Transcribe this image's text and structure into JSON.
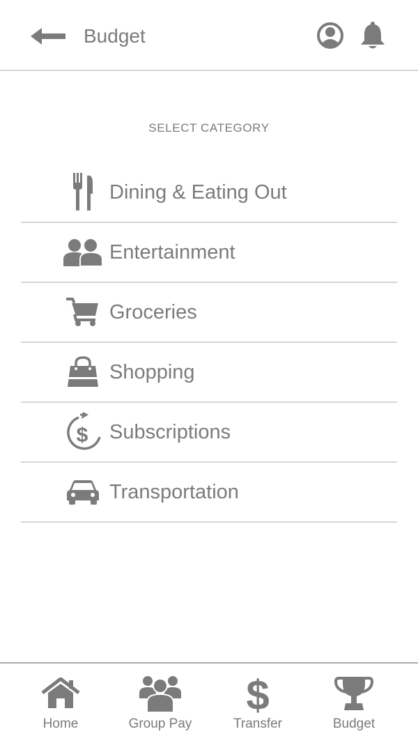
{
  "header": {
    "title": "Budget",
    "back_icon": "arrow-left-icon",
    "profile_icon": "user-circle-icon",
    "notification_icon": "bell-icon"
  },
  "section_title": "SELECT CATEGORY",
  "categories": [
    {
      "label": "Dining & Eating Out",
      "icon": "fork-knife-icon"
    },
    {
      "label": "Entertainment",
      "icon": "people-icon"
    },
    {
      "label": "Groceries",
      "icon": "cart-icon"
    },
    {
      "label": "Shopping",
      "icon": "shopping-bag-icon"
    },
    {
      "label": "Subscriptions",
      "icon": "recurring-dollar-icon"
    },
    {
      "label": "Transportation",
      "icon": "car-icon"
    }
  ],
  "bottom_nav": [
    {
      "label": "Home",
      "icon": "home-icon"
    },
    {
      "label": "Group Pay",
      "icon": "group-icon"
    },
    {
      "label": "Transfer",
      "icon": "dollar-icon"
    },
    {
      "label": "Budget",
      "icon": "trophy-icon"
    }
  ],
  "colors": {
    "icon_gray": "#7b7b7b",
    "divider": "#d5d5d5",
    "nav_border": "#a9a9a9",
    "background": "#ffffff"
  }
}
